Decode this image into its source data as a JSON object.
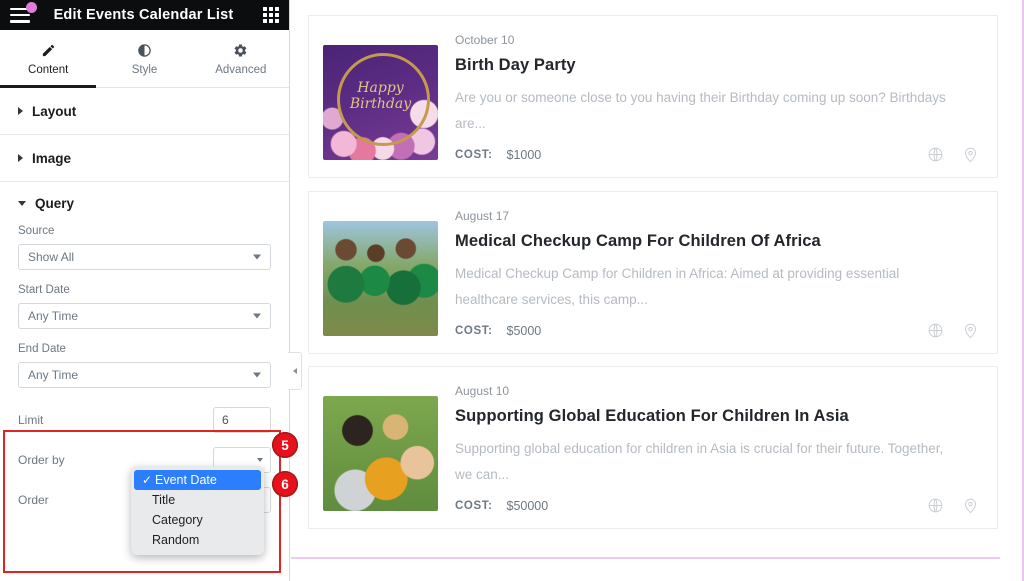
{
  "panel": {
    "title": "Edit Events Calendar List",
    "menu_icon": "hamburger-icon",
    "apps_icon": "grid-apps-icon",
    "tabs": [
      {
        "label": "Content",
        "icon": "pencil-icon",
        "active": true
      },
      {
        "label": "Style",
        "icon": "contrast-icon",
        "active": false
      },
      {
        "label": "Advanced",
        "icon": "gear-icon",
        "active": false
      }
    ],
    "sections": [
      {
        "title": "Layout",
        "expanded": false
      },
      {
        "title": "Image",
        "expanded": false
      },
      {
        "title": "Query",
        "expanded": true
      }
    ],
    "query": {
      "source_label": "Source",
      "source_value": "Show All",
      "start_date_label": "Start Date",
      "start_date_value": "Any Time",
      "end_date_label": "End Date",
      "end_date_value": "Any Time",
      "limit_label": "Limit",
      "limit_value": "6",
      "order_by_label": "Order by",
      "order_label": "Order"
    },
    "dropdown": {
      "open": true,
      "selected": "Event Date",
      "options": [
        "Event Date",
        "Title",
        "Category",
        "Random"
      ],
      "check_glyph": "✓"
    },
    "badges": [
      {
        "number": "5"
      },
      {
        "number": "6"
      }
    ],
    "collapse_icon": "chevron-left-icon"
  },
  "preview": {
    "cards": [
      {
        "date": "October 10",
        "title": "Birth Day Party",
        "description": "Are you or someone close to you having their Birthday coming up soon? Birthdays are...",
        "cost_label": "COST:",
        "cost_value": "$1000",
        "thumb": "birthday-balloons-image",
        "icons": [
          "globe-icon",
          "map-pin-icon"
        ]
      },
      {
        "date": "August 17",
        "title": "Medical Checkup Camp For Children Of Africa",
        "description": "Medical Checkup Camp for Children in Africa: Aimed at providing essential healthcare services, this camp...",
        "cost_label": "COST:",
        "cost_value": "$5000",
        "thumb": "african-children-image",
        "icons": [
          "globe-icon",
          "map-pin-icon"
        ]
      },
      {
        "date": "August 10",
        "title": "Supporting Global Education For Children In Asia",
        "description": "Supporting global education for children in Asia is crucial for their future. Together, we can...",
        "cost_label": "COST:",
        "cost_value": "$50000",
        "thumb": "asian-children-image",
        "icons": [
          "globe-icon",
          "map-pin-icon"
        ]
      }
    ]
  },
  "colors": {
    "header_bg": "#0c0d0e",
    "accent_selected": "#2b7fff",
    "badge_red": "#e8101b",
    "highlight_border": "#e02424",
    "preview_border": "#eec9f2",
    "notification_dot": "#e07bd8"
  }
}
